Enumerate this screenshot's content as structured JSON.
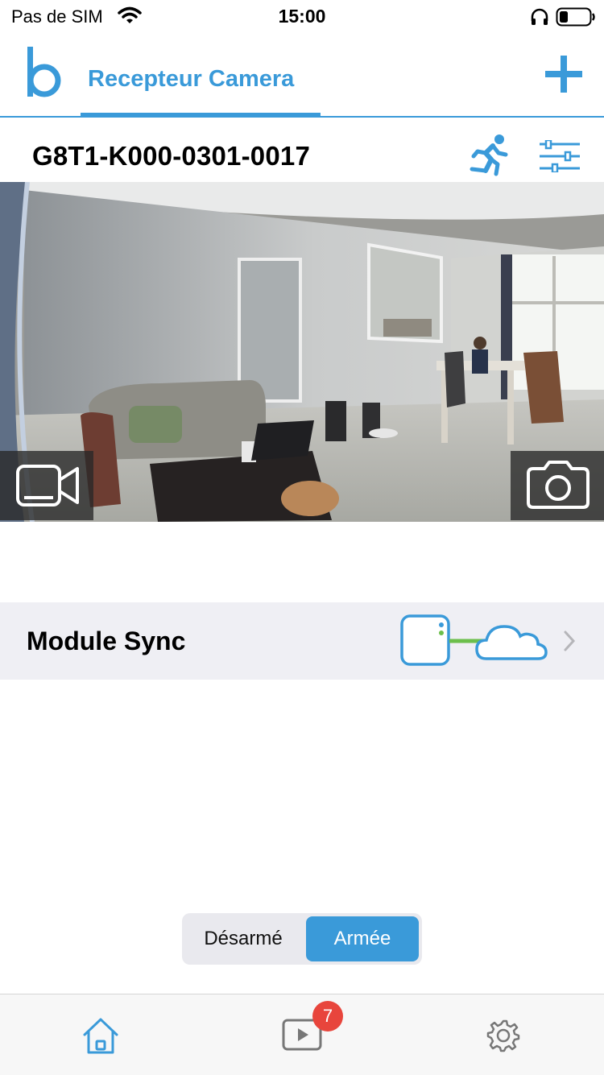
{
  "status_bar": {
    "carrier": "Pas de SIM",
    "time": "15:00"
  },
  "header": {
    "logo_letter": "b",
    "tab_title": "Recepteur Camera",
    "add_icon": "plus-icon"
  },
  "camera": {
    "id": "G8T1-K000-0301-0017",
    "motion_icon": "running-person-icon",
    "settings_icon": "sliders-icon",
    "record_icon": "video-camera-icon",
    "snapshot_icon": "photo-camera-icon"
  },
  "module": {
    "label": "Module Sync",
    "graphic": "sync-module-cloud-icon"
  },
  "arm_toggle": {
    "disarm_label": "Désarmé",
    "arm_label": "Armée",
    "selected": "Armée"
  },
  "tab_bar": {
    "home_icon": "home-icon",
    "clips_icon": "play-icon",
    "clips_badge": "7",
    "settings_icon": "gear-icon"
  },
  "colors": {
    "accent": "#3a9ad9",
    "badge": "#e8453c",
    "module_bg": "#efeff4",
    "sync_link": "#6cbf4b"
  }
}
